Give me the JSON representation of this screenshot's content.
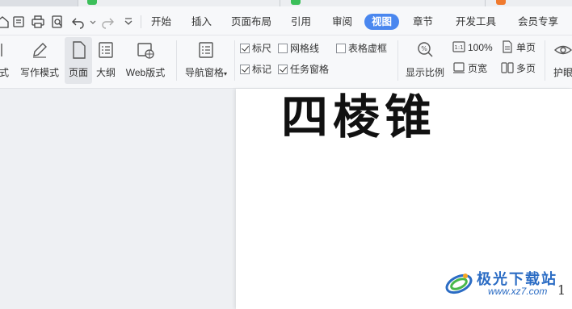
{
  "menu": {
    "items": [
      "开始",
      "插入",
      "页面布局",
      "引用",
      "审阅",
      "视图",
      "章节",
      "开发工具",
      "会员专享"
    ],
    "active": "视图"
  },
  "ribbon": {
    "partial_left_label": "式",
    "writing_mode": "写作模式",
    "page": "页面",
    "outline": "大纲",
    "web_layout": "Web版式",
    "nav_pane": "导航窗格",
    "ruler": "标尺",
    "ruler_checked": true,
    "gridlines": "网格线",
    "gridlines_checked": false,
    "table_virtual_frame": "表格虚框",
    "table_virtual_frame_checked": false,
    "marks": "标记",
    "marks_checked": true,
    "task_pane": "任务窗格",
    "task_pane_checked": true,
    "zoom": "显示比例",
    "zoom_100": "100%",
    "page_width": "页宽",
    "single_page": "单页",
    "multi_page": "多页",
    "eye_protect": "护眼"
  },
  "document": {
    "heading": "四棱锥",
    "page_number": "1"
  },
  "watermark": {
    "brand": "极光下载站",
    "url": "www.xz7.com"
  },
  "colors": {
    "accent": "#4a87ef",
    "watermark": "#2b6cc4"
  }
}
